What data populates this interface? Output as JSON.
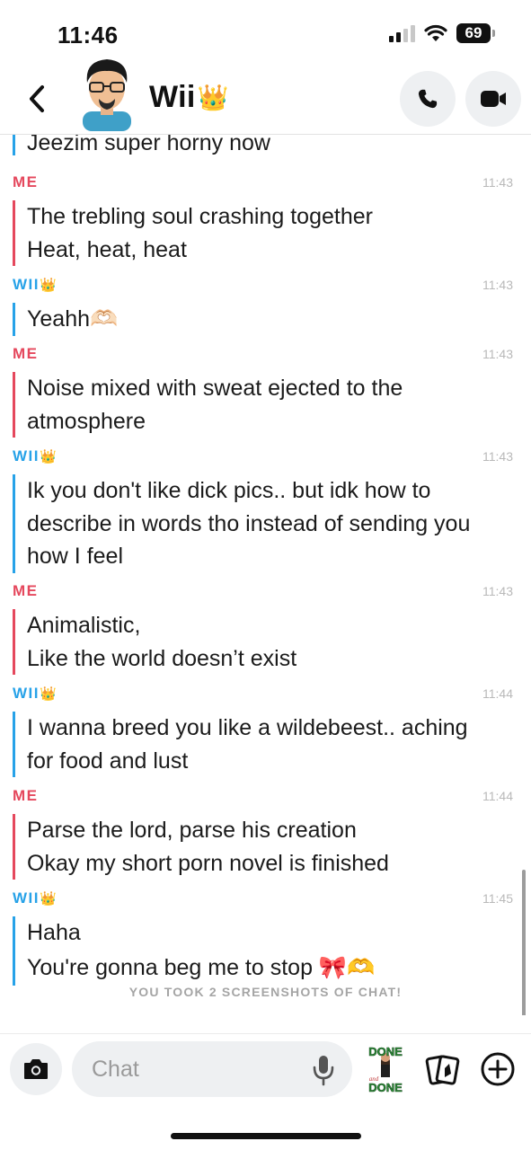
{
  "status_bar": {
    "time": "11:46",
    "battery": "69"
  },
  "header": {
    "title": "Wii",
    "title_emoji": "👑"
  },
  "partial_message": {
    "text": "Jeezim super horny now"
  },
  "messages": [
    {
      "sender": "ME",
      "time": "11:43",
      "lines": [
        "The trebling soul crashing together",
        "Heat, heat, heat"
      ]
    },
    {
      "sender": "WII",
      "sender_emoji": "👑",
      "time": "11:43",
      "lines": [
        "Yeahh🫶🏻"
      ]
    },
    {
      "sender": "ME",
      "time": "11:43",
      "lines": [
        "Noise mixed with sweat ejected to the",
        "atmosphere"
      ]
    },
    {
      "sender": "WII",
      "sender_emoji": "👑",
      "time": "11:43",
      "lines": [
        "Ik you don't like dick pics.. but idk how to",
        "describe in words tho instead of sending you",
        "how I feel"
      ]
    },
    {
      "sender": "ME",
      "time": "11:43",
      "lines": [
        "Animalistic,",
        "Like the world doesn’t exist"
      ]
    },
    {
      "sender": "WII",
      "sender_emoji": "👑",
      "time": "11:44",
      "lines": [
        "I wanna breed you like a wildebeest.. aching",
        "for food and lust"
      ]
    },
    {
      "sender": "ME",
      "time": "11:44",
      "lines": [
        "Parse the lord, parse his creation",
        "Okay my short porn novel is finished"
      ]
    },
    {
      "sender": "WII",
      "sender_emoji": "👑",
      "time": "11:45",
      "lines": [
        "Haha",
        "You're gonna beg me to stop 🎀🫶"
      ]
    }
  ],
  "screenshot_notice": "YOU TOOK 2 SCREENSHOTS OF CHAT!",
  "input": {
    "placeholder": "Chat"
  },
  "sticker": {
    "top": "DONE",
    "mid": "and",
    "bottom": "DONE"
  },
  "colors": {
    "me": "#e5485d",
    "them": "#27a2e8"
  }
}
